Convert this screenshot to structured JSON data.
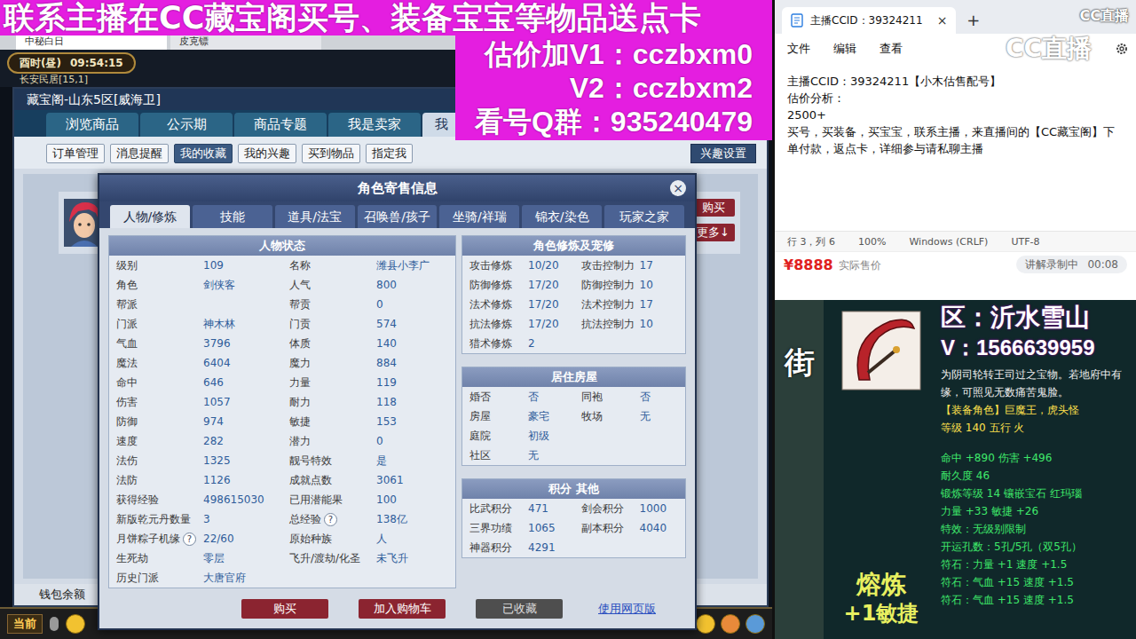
{
  "banner": {
    "headline": "联系主播在CC藏宝阁买号、装备宝宝等物品送点卡",
    "lines": [
      "估价加V1：cczbxm0",
      "V2：cczbxm2",
      "看号Q群：935240479"
    ]
  },
  "game": {
    "browser_tabs": [
      {
        "label": "中秘白日",
        "selected": true
      },
      {
        "label": "皮克镖",
        "selected": false
      }
    ],
    "clock": {
      "period": "酉时(昼)",
      "time": "09:54:15"
    },
    "location": "长安民居[15,1]",
    "panel_title": "藏宝阁-山东5区[威海卫]",
    "main_tabs": [
      {
        "label": "浏览商品",
        "selected": false
      },
      {
        "label": "公示期",
        "selected": false
      },
      {
        "label": "商品专题",
        "selected": false
      },
      {
        "label": "我是卖家",
        "selected": false
      },
      {
        "label": "我",
        "selected": true
      }
    ],
    "sub_tabs": [
      {
        "label": "订单管理",
        "selected": false
      },
      {
        "label": "消息提醒",
        "selected": false
      },
      {
        "label": "我的收藏",
        "selected": true
      },
      {
        "label": "我的兴趣",
        "selected": false
      },
      {
        "label": "买到物品",
        "selected": false
      },
      {
        "label": "指定我",
        "selected": false
      }
    ],
    "interest_button": "兴趣设置",
    "side_buttons": [
      "购买",
      "更多↓"
    ],
    "wallet_label": "钱包余额",
    "toolbar_label": "当前"
  },
  "modal": {
    "title": "角色寄售信息",
    "close": "×",
    "help_icon": "?",
    "tabs": [
      {
        "label": "人物/修炼",
        "selected": true
      },
      {
        "label": "技能",
        "selected": false
      },
      {
        "label": "道具/法宝",
        "selected": false
      },
      {
        "label": "召唤兽/孩子",
        "selected": false
      },
      {
        "label": "坐骑/祥瑞",
        "selected": false
      },
      {
        "label": "锦衣/染色",
        "selected": false
      },
      {
        "label": "玩家之家",
        "selected": false
      }
    ],
    "status": {
      "title": "人物状态",
      "columns": [
        [
          {
            "label": "级别",
            "value": "109",
            "help": false
          },
          {
            "label": "角色",
            "value": "剑侠客",
            "help": false
          },
          {
            "label": "帮派",
            "value": "",
            "help": false
          },
          {
            "label": "门派",
            "value": "神木林",
            "help": false
          },
          {
            "label": "气血",
            "value": "3796",
            "help": false
          },
          {
            "label": "魔法",
            "value": "6404",
            "help": false
          },
          {
            "label": "命中",
            "value": "646",
            "help": false
          },
          {
            "label": "伤害",
            "value": "1057",
            "help": false
          },
          {
            "label": "防御",
            "value": "974",
            "help": false
          },
          {
            "label": "速度",
            "value": "282",
            "help": false
          },
          {
            "label": "法伤",
            "value": "1325",
            "help": false
          },
          {
            "label": "法防",
            "value": "1126",
            "help": false
          },
          {
            "label": "获得经验",
            "value": "498615030",
            "help": false
          },
          {
            "label": "新版乾元丹数量",
            "value": "3",
            "help": false
          },
          {
            "label": "月饼粽子机缘",
            "value": "22/60",
            "help": true
          },
          {
            "label": "生死劫",
            "value": "零层",
            "help": false
          },
          {
            "label": "历史门派",
            "value": "大唐官府",
            "help": false
          }
        ],
        [
          {
            "label": "名称",
            "value": "潍县小李广",
            "help": false
          },
          {
            "label": "人气",
            "value": "800",
            "help": false
          },
          {
            "label": "帮贡",
            "value": "0",
            "help": false
          },
          {
            "label": "门贡",
            "value": "574",
            "help": false
          },
          {
            "label": "体质",
            "value": "140",
            "help": false
          },
          {
            "label": "魔力",
            "value": "884",
            "help": false
          },
          {
            "label": "力量",
            "value": "119",
            "help": false
          },
          {
            "label": "耐力",
            "value": "118",
            "help": false
          },
          {
            "label": "敏捷",
            "value": "153",
            "help": false
          },
          {
            "label": "潜力",
            "value": "0",
            "help": false
          },
          {
            "label": "靓号特效",
            "value": "是",
            "help": false
          },
          {
            "label": "成就点数",
            "value": "3061",
            "help": false
          },
          {
            "label": "已用潜能果",
            "value": "100",
            "help": false
          },
          {
            "label": "总经验",
            "value": "138亿",
            "help": true
          },
          {
            "label": "原始种族",
            "value": "人",
            "help": false
          },
          {
            "label": "飞升/渡劫/化圣",
            "value": "未飞升",
            "help": false
          }
        ]
      ]
    },
    "sections": [
      {
        "title": "角色修炼及宠修",
        "columns": [
          [
            {
              "label": "攻击修炼",
              "value": "10/20",
              "help": false
            },
            {
              "label": "防御修炼",
              "value": "17/20",
              "help": false
            },
            {
              "label": "法术修炼",
              "value": "17/20",
              "help": false
            },
            {
              "label": "抗法修炼",
              "value": "17/20",
              "help": false
            },
            {
              "label": "猎术修炼",
              "value": "2",
              "help": false
            }
          ],
          [
            {
              "label": "攻击控制力",
              "value": "17",
              "help": false
            },
            {
              "label": "防御控制力",
              "value": "10",
              "help": false
            },
            {
              "label": "法术控制力",
              "value": "17",
              "help": false
            },
            {
              "label": "抗法控制力",
              "value": "10",
              "help": false
            }
          ]
        ]
      },
      {
        "title": "居住房屋",
        "columns": [
          [
            {
              "label": "婚否",
              "value": "否",
              "help": false
            },
            {
              "label": "房屋",
              "value": "豪宅",
              "help": false
            },
            {
              "label": "庭院",
              "value": "初级",
              "help": false
            },
            {
              "label": "社区",
              "value": "无",
              "help": false
            }
          ],
          [
            {
              "label": "同袍",
              "value": "否",
              "help": false
            },
            {
              "label": "牧场",
              "value": "无",
              "help": false
            }
          ]
        ]
      },
      {
        "title": "积分 其他",
        "columns": [
          [
            {
              "label": "比武积分",
              "value": "471",
              "help": false
            },
            {
              "label": "三界功绩",
              "value": "1065",
              "help": false
            },
            {
              "label": "神器积分",
              "value": "4291",
              "help": false
            }
          ],
          [
            {
              "label": "剑会积分",
              "value": "1000",
              "help": false
            },
            {
              "label": "副本积分",
              "value": "4040",
              "help": false
            }
          ]
        ]
      }
    ],
    "buttons": [
      {
        "label": "购买",
        "kind": "primary"
      },
      {
        "label": "加入购物车",
        "kind": "primary"
      },
      {
        "label": "已收藏",
        "kind": "disabled"
      },
      {
        "label": "使用网页版",
        "kind": "link"
      }
    ]
  },
  "notepad": {
    "title": "主播CCID：39324211",
    "close": "×",
    "new_tab": "+",
    "menus": [
      "文件",
      "编辑",
      "查看"
    ],
    "lines": [
      "主播CCID：39324211【小木估售配号】",
      "估价分析：",
      "2500+",
      "买号，买装备，买宝宝，联系主播，来直播间的【CC藏宝阁】下单付款，返点卡，详细参与请私聊主播"
    ],
    "status": [
      "行 3，列 6",
      "100%",
      "Windows (CRLF)",
      "UTF-8"
    ],
    "corner_logo": "CC直播",
    "watermark": "CC直播"
  },
  "price_strip": {
    "price": "¥8888",
    "price_label": "实际售价",
    "recording": "讲解录制中",
    "timer": "00:08"
  },
  "item_view": {
    "side_label": "街",
    "region": "区：沂水雪山",
    "contact": "V：1566639959",
    "smelt": "熔炼",
    "smelt_bonus": "+1敏捷",
    "lines": [
      {
        "text": "为阴司轮转王司过之宝物。若地府中有",
        "kind": "desc"
      },
      {
        "text": "缘，可照见无数痛苦鬼脸。",
        "kind": "desc"
      },
      {
        "text": "【装备角色】巨魔王，虎头怪",
        "kind": "role"
      },
      {
        "text": "等级 140 五行 火",
        "kind": "level"
      },
      {
        "text": "命中 +890 伤害 +496",
        "kind": "stat"
      },
      {
        "text": "耐久度 46",
        "kind": "stat"
      },
      {
        "text": "锻炼等级 14 镶嵌宝石 红玛瑙",
        "kind": "stat"
      },
      {
        "text": "力量 +33 敏捷 +26",
        "kind": "stat"
      },
      {
        "text": "特效：无级别限制",
        "kind": "stat"
      },
      {
        "text": "开运孔数：5孔/5孔（双5孔）",
        "kind": "stat"
      },
      {
        "text": "符石：力量 +1 速度 +1.5",
        "kind": "stat"
      },
      {
        "text": "符石：气血 +15 速度 +1.5",
        "kind": "stat"
      },
      {
        "text": "符石：气血 +15 速度 +1.5",
        "kind": "stat"
      }
    ]
  }
}
